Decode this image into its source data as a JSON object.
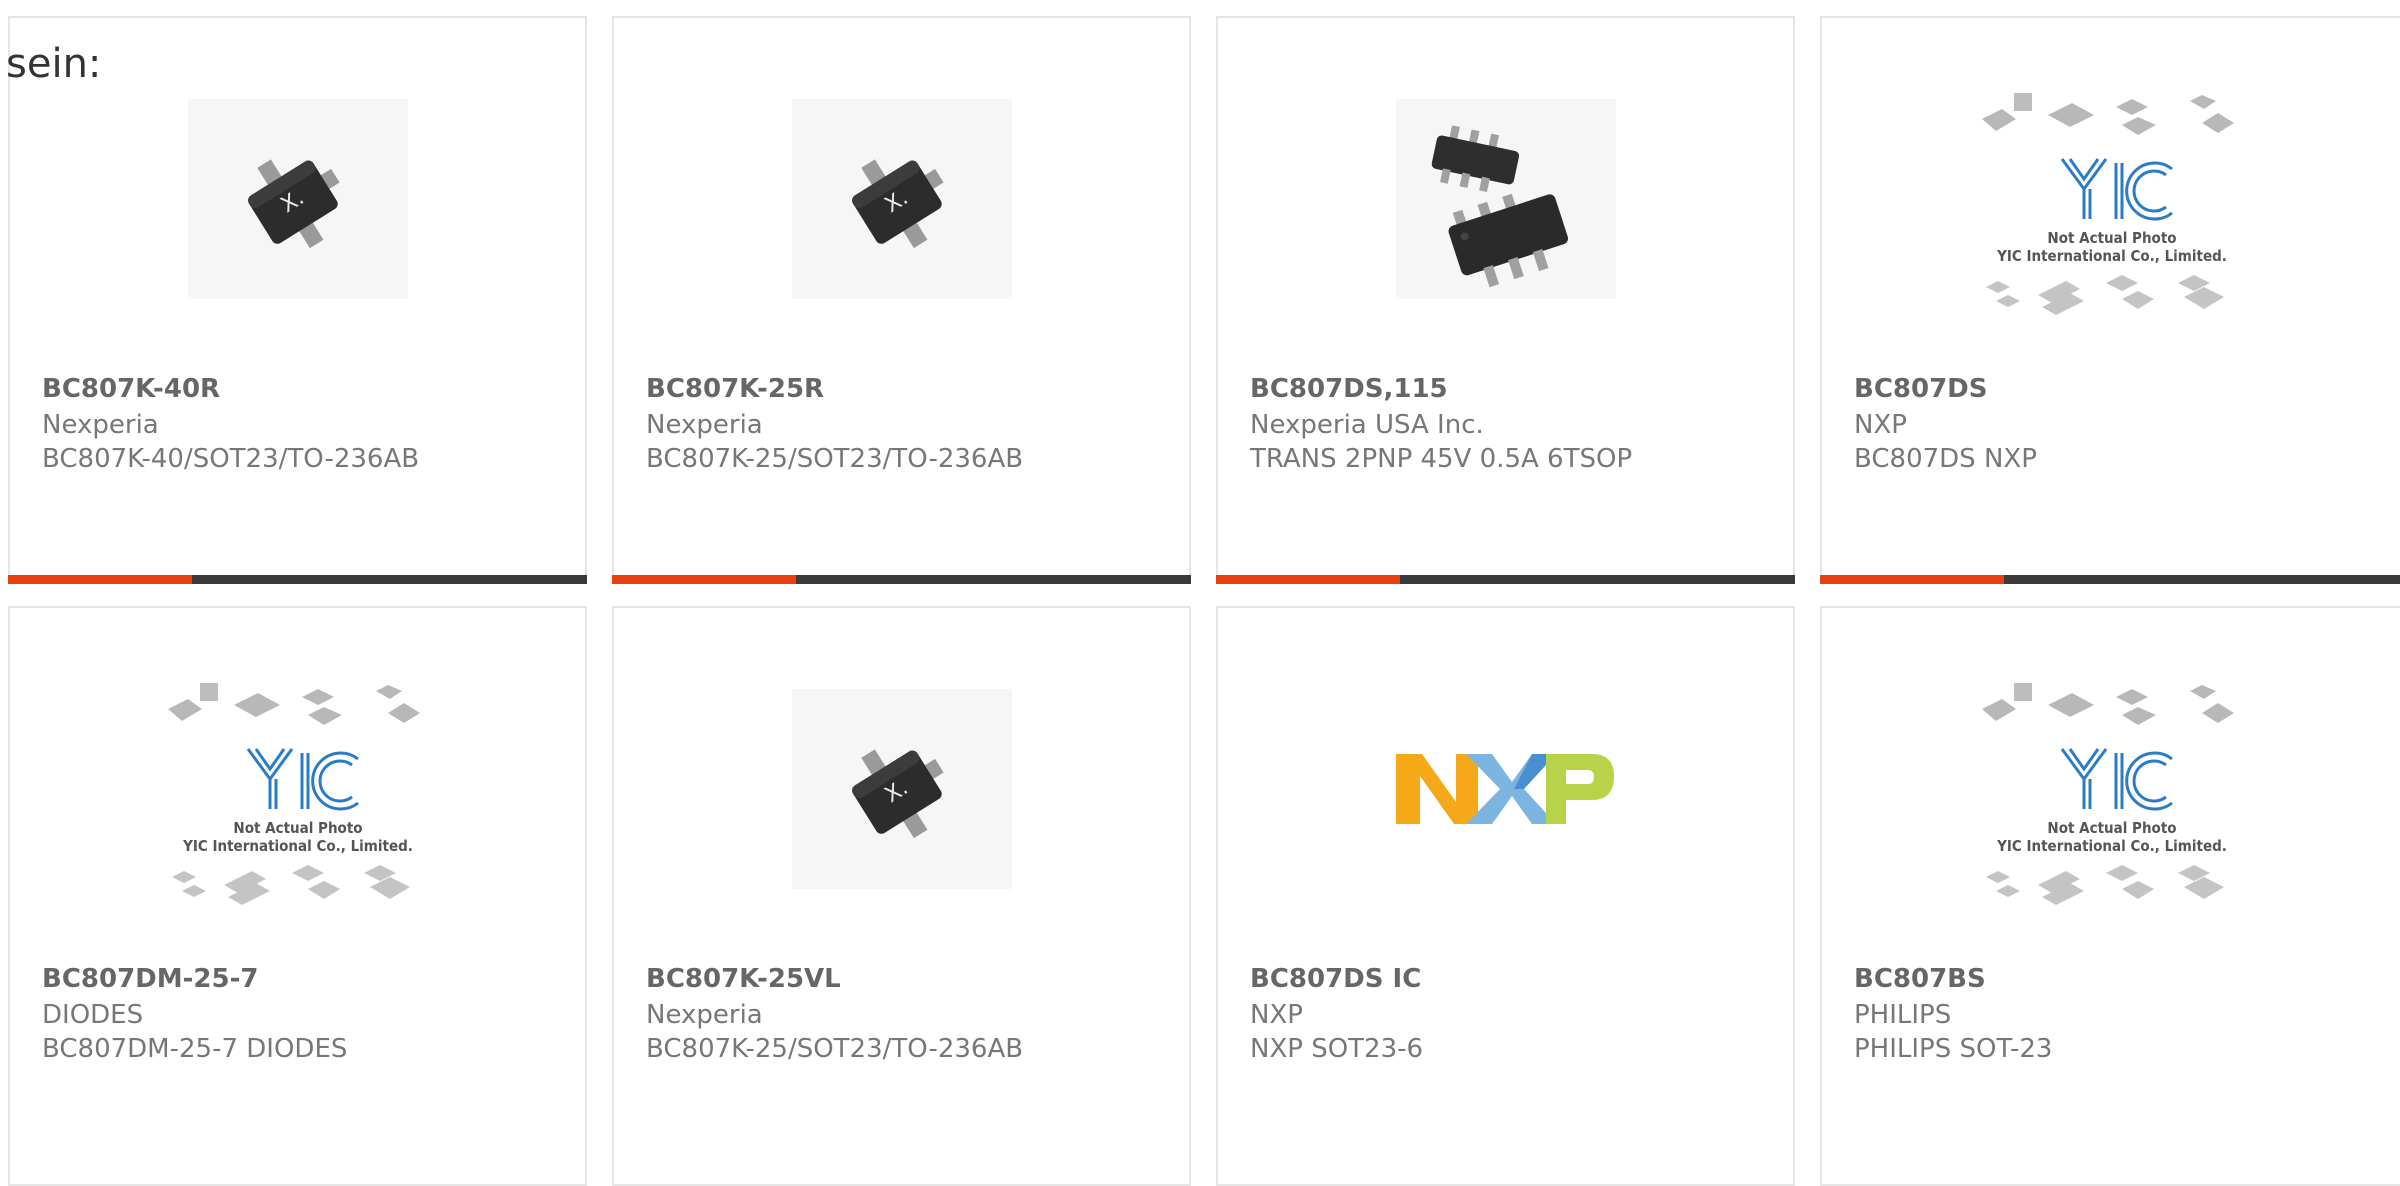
{
  "intro_text": "sein:",
  "accent_color": "#e8410f",
  "bar_color": "#3a3a3a",
  "placeholder": {
    "line1": "Not Actual Photo",
    "line2": "YIC International Co., Limited."
  },
  "products": [
    {
      "part": "BC807K-40R",
      "maker": "Nexperia",
      "desc": "BC807K-40/SOT23/TO-236AB",
      "image": "sot23-chip-icon"
    },
    {
      "part": "BC807K-25R",
      "maker": "Nexperia",
      "desc": "BC807K-25/SOT23/TO-236AB",
      "image": "sot23-chip-icon"
    },
    {
      "part": "BC807DS,115",
      "maker": "Nexperia USA Inc.",
      "desc": "TRANS 2PNP 45V 0.5A 6TSOP",
      "image": "tsop6-chip-icon"
    },
    {
      "part": "BC807DS",
      "maker": "NXP",
      "desc": "BC807DS NXP",
      "image": "yic-placeholder-image"
    },
    {
      "part": "BC807DM-25-7",
      "maker": "DIODES",
      "desc": "BC807DM-25-7 DIODES",
      "image": "yic-placeholder-image"
    },
    {
      "part": "BC807K-25VL",
      "maker": "Nexperia",
      "desc": "BC807K-25/SOT23/TO-236AB",
      "image": "sot23-chip-icon"
    },
    {
      "part": "BC807DS IC",
      "maker": "NXP",
      "desc": "NXP SOT23-6",
      "image": "nxp-logo"
    },
    {
      "part": "BC807BS",
      "maker": "PHILIPS",
      "desc": "PHILIPS SOT-23",
      "image": "yic-placeholder-image"
    }
  ]
}
